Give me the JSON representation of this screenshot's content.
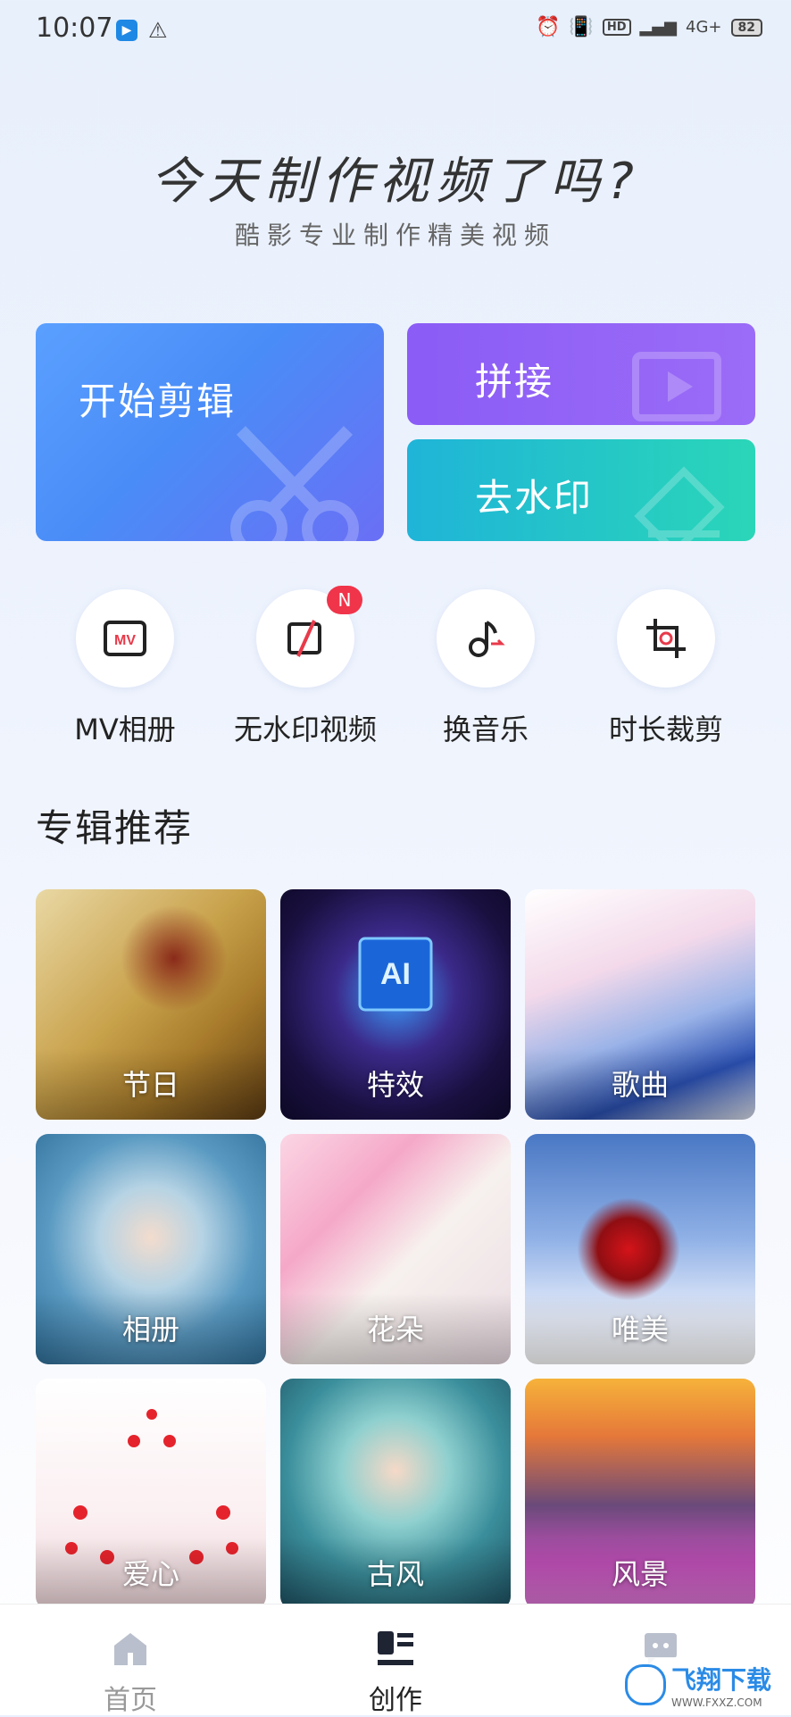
{
  "status": {
    "time": "10:07",
    "hd": "HD",
    "net": "4G+",
    "battery": "82"
  },
  "header": {
    "title": "今天制作视频了吗?",
    "subtitle": "酷影专业制作精美视频"
  },
  "cards": {
    "edit": "开始剪辑",
    "join": "拼接",
    "watermark": "去水印"
  },
  "tools": [
    {
      "label": "MV相册",
      "icon": "mv-icon"
    },
    {
      "label": "无水印视频",
      "icon": "no-watermark-icon",
      "badge": "N"
    },
    {
      "label": "换音乐",
      "icon": "music-note-icon"
    },
    {
      "label": "时长裁剪",
      "icon": "crop-icon"
    }
  ],
  "section": {
    "title": "专辑推荐"
  },
  "albums": [
    "节日",
    "特效",
    "歌曲",
    "相册",
    "花朵",
    "唯美",
    "爱心",
    "古风",
    "风景"
  ],
  "tabs": [
    "首页",
    "创作"
  ],
  "watermark": {
    "name": "飞翔下载",
    "url": "WWW.FXXZ.COM"
  },
  "colors": {
    "edit_card": "#4a8cf7",
    "join_card": "#8b5cf6",
    "watermark_card": "#2ad6b8",
    "badge": "#f0344a"
  }
}
